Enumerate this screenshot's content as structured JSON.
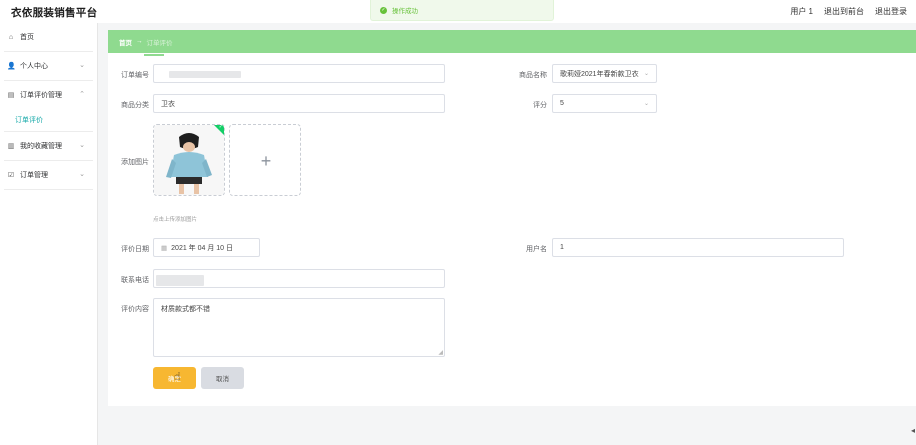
{
  "header": {
    "brand": "衣依服装销售平台",
    "user": "用户 1",
    "back_front": "退出到前台",
    "logout": "退出登录"
  },
  "toast": {
    "message": "操作成功",
    "icon": "success-check-icon"
  },
  "sidebar": {
    "items": [
      {
        "label": "首页",
        "icon": "home-icon"
      },
      {
        "label": "个人中心",
        "icon": "user-icon"
      },
      {
        "label": "订单评价管理",
        "icon": "briefcase-icon"
      },
      {
        "label": "订单评价",
        "icon": ""
      },
      {
        "label": "我的收藏管理",
        "icon": "collection-icon"
      },
      {
        "label": "订单管理",
        "icon": "order-icon"
      }
    ]
  },
  "breadcrumb": {
    "home": "首页",
    "separator": "→",
    "current": "订单评价"
  },
  "form": {
    "order_no_label": "订单编号",
    "product_name_label": "商品名称",
    "product_name_value": "歌莉娅2021年春新款卫衣",
    "category_label": "商品分类",
    "category_value": "卫衣",
    "rating_label": "评分",
    "rating_value": "5",
    "image_label": "添加图片",
    "upload_hint": "点击上传添加图片",
    "date_label": "评价日期",
    "date_value": "2021 年 04 月 10 日",
    "username_label": "用户名",
    "username_value": "1",
    "phone_label": "联系电话",
    "comment_label": "评价内容",
    "comment_value": "材质款式都不错",
    "confirm_button": "确定",
    "cancel_button": "取消"
  }
}
